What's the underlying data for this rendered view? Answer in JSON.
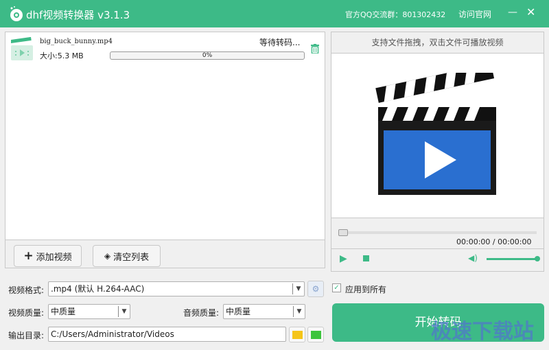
{
  "titlebar": {
    "title": "dhf视频转换器 v3.1.3",
    "qq": "官方QQ交流群：801302432",
    "site": "访问官网",
    "minimize": "—",
    "close": "✕"
  },
  "files": [
    {
      "name": "big_buck_bunny.mp4",
      "size": "大小:5.3 MB",
      "status": "等待转码...",
      "progress": "0%",
      "progress_value": 0
    }
  ],
  "toolbar": {
    "add": "添加视频",
    "clear": "清空列表"
  },
  "player": {
    "hint": "支持文件拖拽，双击文件可播放视频",
    "time": "00:00:00 / 00:00:00",
    "seek": 0,
    "volume": 100
  },
  "form": {
    "format_label": "视频格式:",
    "format_value": ".mp4 (默认 H.264-AAC)",
    "apply_all": "应用到所有",
    "apply_all_checked": true,
    "vquality_label": "视频质量:",
    "vquality_value": "中质量",
    "aquality_label": "音频质量:",
    "aquality_value": "中质量",
    "output_label": "输出目录:",
    "output_value": "C:/Users/Administrator/Videos"
  },
  "start": "开始转码",
  "watermark": "极速下载站",
  "colors": {
    "accent": "#3dba87"
  }
}
